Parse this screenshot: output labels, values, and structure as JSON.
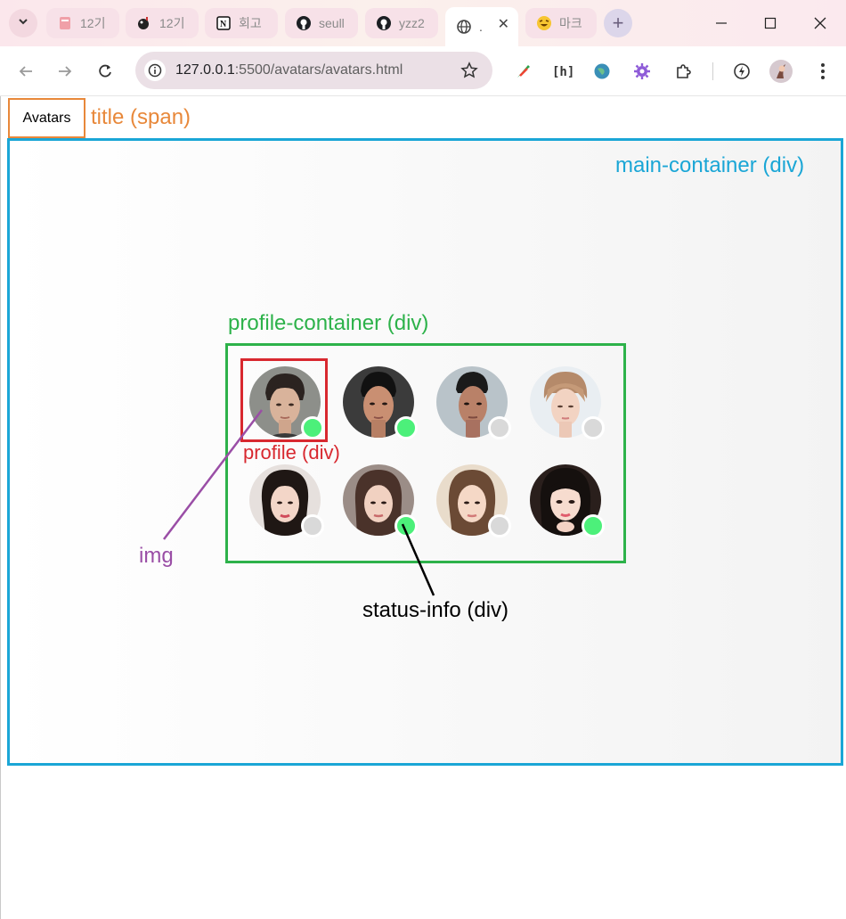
{
  "browser": {
    "tabs": [
      {
        "title": "12기",
        "icon": "notes-icon",
        "active": false
      },
      {
        "title": "12기",
        "icon": "bomb-icon",
        "active": false
      },
      {
        "title": "회고",
        "icon": "notion-icon",
        "active": false
      },
      {
        "title": "seull",
        "icon": "github-icon",
        "active": false
      },
      {
        "title": "yzz2",
        "icon": "github-icon",
        "active": false
      },
      {
        "title": ".",
        "icon": "globe-icon",
        "active": true
      },
      {
        "title": "마크",
        "icon": "emoji-laugh-icon",
        "active": false
      }
    ],
    "url_host": "127.0.0.1",
    "url_rest": ":5500/avatars/avatars.html",
    "accent": "#fbe7ec"
  },
  "page": {
    "title": "Avatars",
    "annotations": {
      "title": "title (span)",
      "main_container": "main-container (div)",
      "profile_container": "profile-container (div)",
      "profile": "profile (div)",
      "img": "img",
      "status_info": "status-info (div)"
    },
    "profiles": [
      {
        "status": "online"
      },
      {
        "status": "online"
      },
      {
        "status": "offline"
      },
      {
        "status": "offline"
      },
      {
        "status": "offline"
      },
      {
        "status": "online"
      },
      {
        "status": "offline"
      },
      {
        "status": "online"
      }
    ],
    "colors": {
      "online": "#4cf07a",
      "offline": "#d9d9d9",
      "title_box": "#e8883a",
      "main_container": "#1aa6d6",
      "profile_container": "#2db24a",
      "profile": "#d8282f",
      "img_label": "#9a4ea6"
    }
  }
}
